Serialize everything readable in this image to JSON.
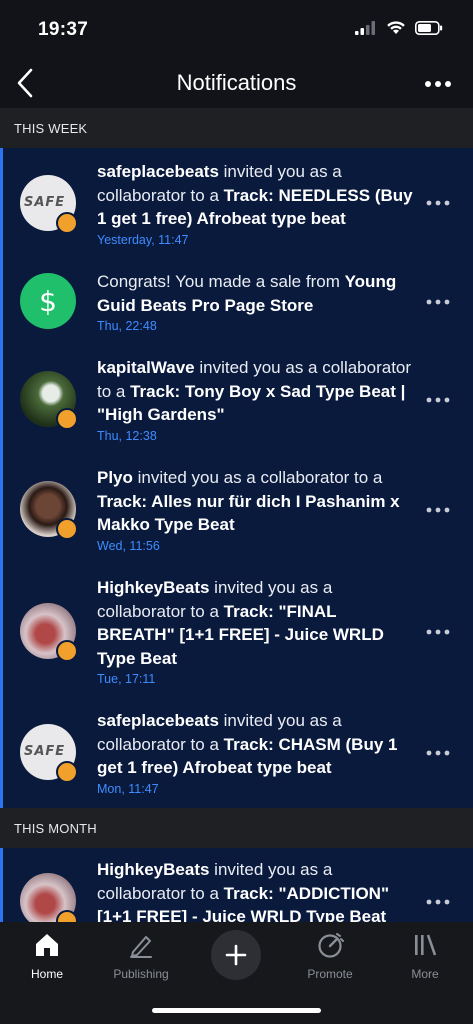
{
  "status": {
    "time": "19:37"
  },
  "header": {
    "title": "Notifications"
  },
  "sections": {
    "this_week": "THIS WEEK",
    "this_month": "THIS MONTH"
  },
  "notifications": [
    {
      "actor": "safeplacebeats",
      "mid": " invited you as a collaborator to a ",
      "kind": "Track:",
      "item": " NEEDLESS (Buy 1 get 1 free) Afrobeat type beat",
      "time": "Yesterday, 11:47",
      "avatar_text": "SAFE"
    },
    {
      "pre": "Congrats! You made a sale from ",
      "item": "Young Guid Beats Pro Page Store",
      "time": "Thu, 22:48",
      "icon": "dollar-icon"
    },
    {
      "actor": "kapitalWave",
      "mid": " invited you as a collaborator to a ",
      "kind": "Track:",
      "item": " Tony Boy x Sad Type Beat | \"High Gardens\"",
      "time": "Thu, 12:38"
    },
    {
      "actor": "Plyo",
      "mid": " invited you as a collaborator to a ",
      "kind": "Track:",
      "item": " Alles nur für dich I Pashanim x Makko Type Beat",
      "time": "Wed, 11:56"
    },
    {
      "actor": "HighkeyBeats",
      "mid": " invited you as a collaborator to a ",
      "kind": "Track:",
      "item": " \"FINAL BREATH\" [1+1 FREE] - Juice WRLD Type Beat",
      "time": "Tue, 17:11"
    },
    {
      "actor": "safeplacebeats",
      "mid": " invited you as a collaborator to a ",
      "kind": "Track:",
      "item": " CHASM (Buy 1 get 1 free) Afrobeat type beat",
      "time": "Mon, 11:47",
      "avatar_text": "SAFE"
    },
    {
      "actor": "HighkeyBeats",
      "mid": " invited you as a collaborator to a ",
      "kind": "Track:",
      "item": " \"ADDICTION\" [1+1 FREE] - Juice WRLD Type Beat",
      "time": ""
    }
  ],
  "tabs": {
    "home": "Home",
    "publishing": "Publishing",
    "promote": "Promote",
    "more": "More"
  },
  "colors": {
    "accent": "#2c73ee",
    "timestamp": "#3e8cff",
    "sale_green": "#1fbf6b",
    "badge": "#f0a02b",
    "list_bg": "#0a1a3d"
  }
}
